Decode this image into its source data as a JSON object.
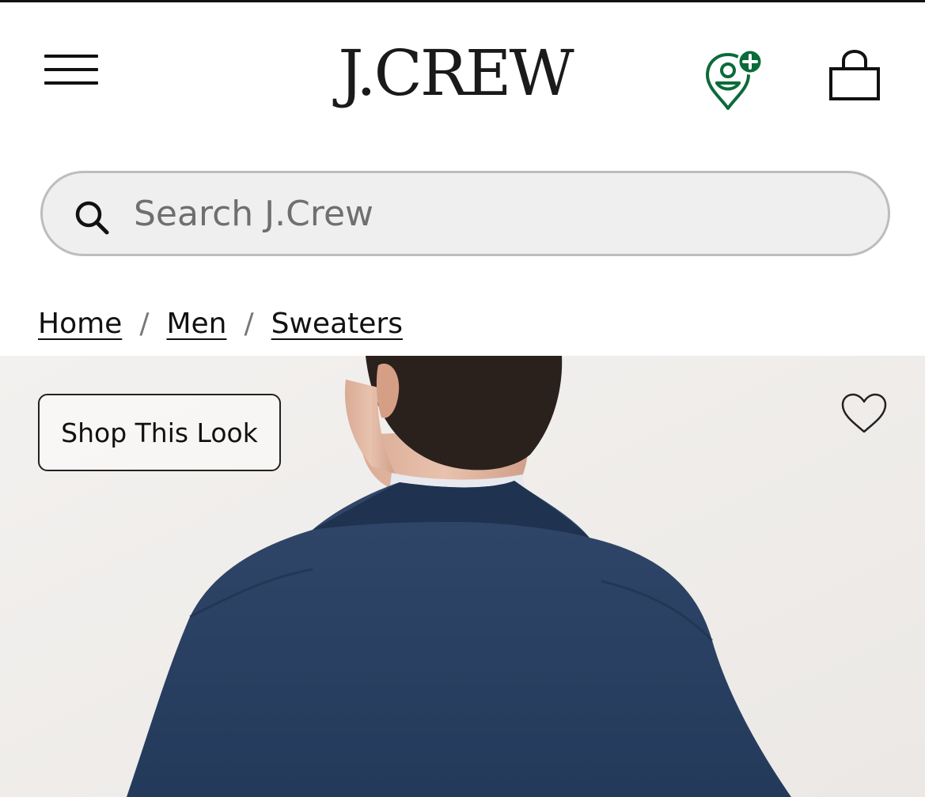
{
  "brand": {
    "logo_text": "J.CREW"
  },
  "header": {
    "menu_icon": "hamburger-menu-icon",
    "rewards_icon": "rewards-location-plus-icon",
    "bag_icon": "shopping-bag-icon",
    "rewards_color": "#0b6b3a"
  },
  "search": {
    "placeholder": "Search J.Crew",
    "icon": "search-icon"
  },
  "breadcrumb": {
    "items": [
      {
        "label": "Home"
      },
      {
        "label": "Men"
      },
      {
        "label": "Sweaters"
      }
    ],
    "separator": "/"
  },
  "hero": {
    "shop_look_label": "Shop This Look",
    "favorite_icon": "heart-outline-icon",
    "image_subject": "man-navy-knit-jacket-back"
  }
}
